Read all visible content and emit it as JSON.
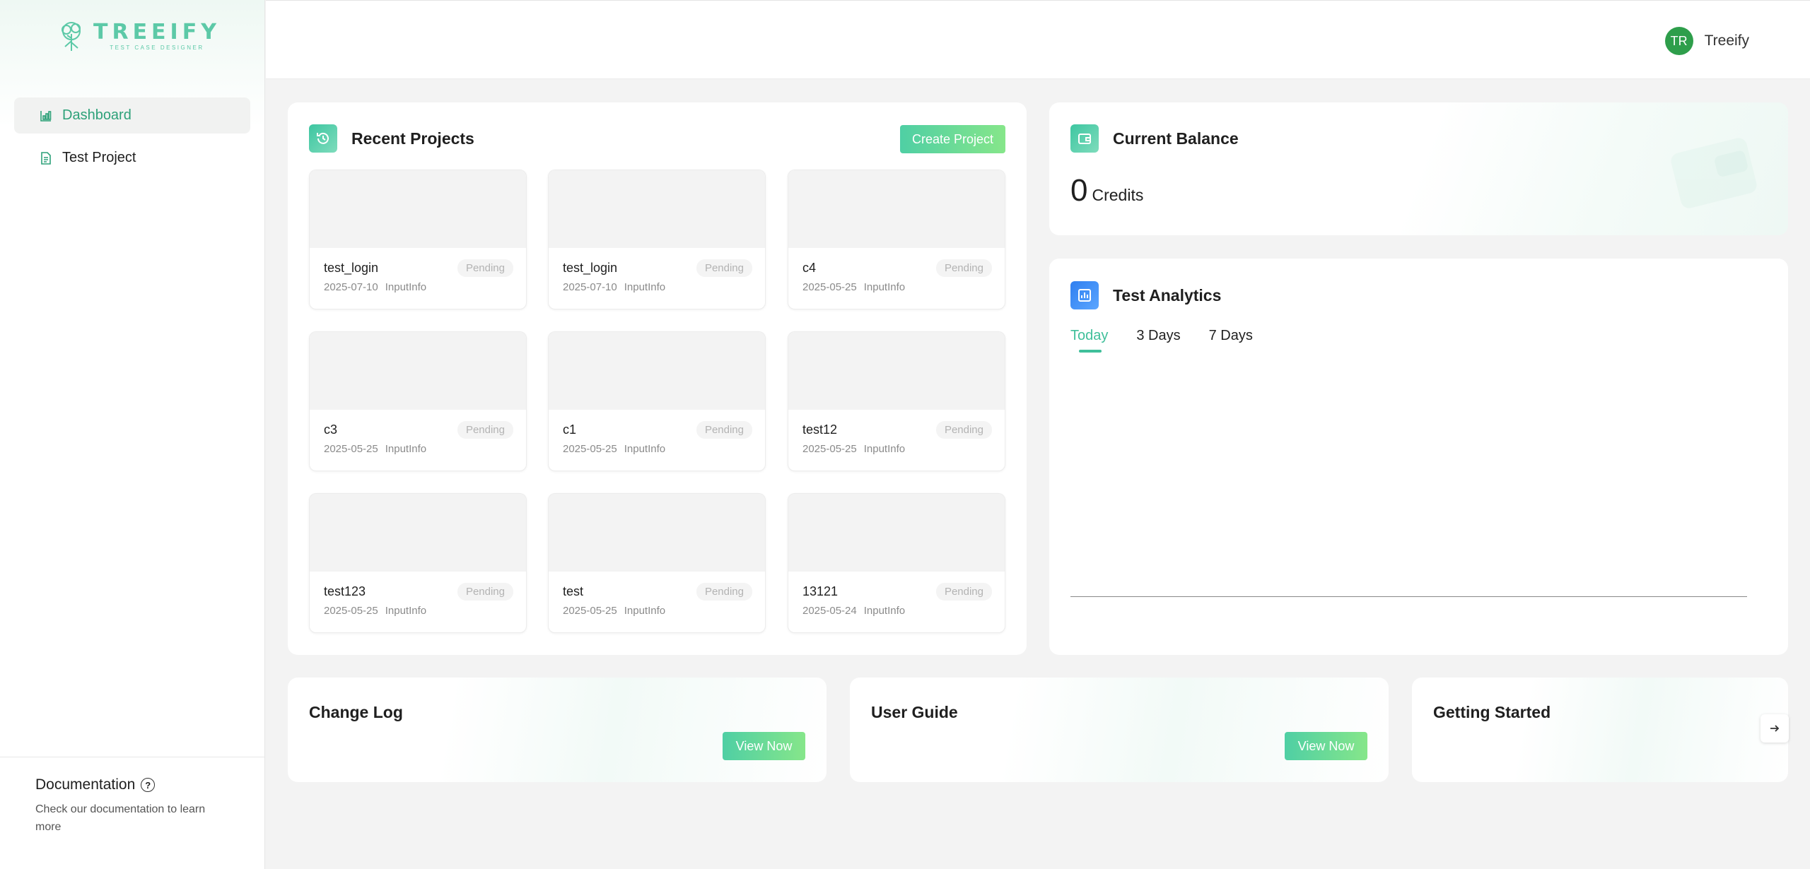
{
  "brand": {
    "name": "TREEIFY",
    "tagline": "TEST CASE DESIGNER",
    "accent": "#5cc9a7"
  },
  "sidebar": {
    "items": [
      {
        "label": "Dashboard",
        "icon": "dashboard-icon",
        "active": true
      },
      {
        "label": "Test Project",
        "icon": "document-icon",
        "active": false
      }
    ],
    "docs": {
      "title": "Documentation",
      "description": "Check our documentation to learn more"
    }
  },
  "header": {
    "user": {
      "initials": "TR",
      "name": "Treeify",
      "avatar_color": "#2e9e4b"
    }
  },
  "recent_projects": {
    "title": "Recent Projects",
    "create_label": "Create Project",
    "projects": [
      {
        "name": "test_login",
        "status": "Pending",
        "date": "2025-07-10",
        "source": "InputInfo"
      },
      {
        "name": "test_login",
        "status": "Pending",
        "date": "2025-07-10",
        "source": "InputInfo"
      },
      {
        "name": "c4",
        "status": "Pending",
        "date": "2025-05-25",
        "source": "InputInfo"
      },
      {
        "name": "c3",
        "status": "Pending",
        "date": "2025-05-25",
        "source": "InputInfo"
      },
      {
        "name": "c1",
        "status": "Pending",
        "date": "2025-05-25",
        "source": "InputInfo"
      },
      {
        "name": "test12",
        "status": "Pending",
        "date": "2025-05-25",
        "source": "InputInfo"
      },
      {
        "name": "test123",
        "status": "Pending",
        "date": "2025-05-25",
        "source": "InputInfo"
      },
      {
        "name": "test",
        "status": "Pending",
        "date": "2025-05-25",
        "source": "InputInfo"
      },
      {
        "name": "13121",
        "status": "Pending",
        "date": "2025-05-24",
        "source": "InputInfo"
      }
    ]
  },
  "balance": {
    "title": "Current Balance",
    "value": "0",
    "unit": "Credits"
  },
  "analytics": {
    "title": "Test Analytics",
    "tabs": [
      {
        "label": "Today",
        "active": true
      },
      {
        "label": "3 Days",
        "active": false
      },
      {
        "label": "7 Days",
        "active": false
      }
    ]
  },
  "bottom_cards": {
    "changelog": {
      "title": "Change Log",
      "button": "View Now"
    },
    "userguide": {
      "title": "User Guide",
      "button": "View Now"
    },
    "started": {
      "title": "Getting Started"
    }
  }
}
